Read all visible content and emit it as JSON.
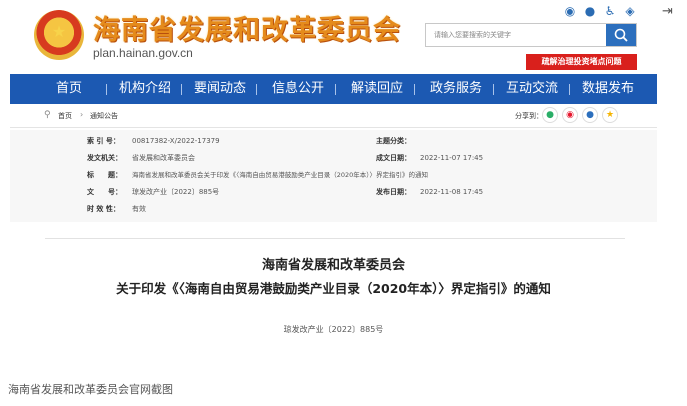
{
  "header": {
    "site_title": "海南省发展和改革委员会",
    "site_domain": "plan.hainan.gov.cn",
    "search_placeholder": "请输入您要搜索的关键字",
    "promo_label": "疏解治理投资堵点问题",
    "top_icons": [
      "weibo-icon",
      "wechat-icon",
      "accessibility-icon",
      "weibo-share-icon"
    ]
  },
  "nav": {
    "items": [
      {
        "label": "首页"
      },
      {
        "label": "机构介绍"
      },
      {
        "label": "要闻动态"
      },
      {
        "label": "信息公开"
      },
      {
        "label": "解读回应"
      },
      {
        "label": "政务服务"
      },
      {
        "label": "互动交流"
      },
      {
        "label": "数据发布"
      }
    ]
  },
  "breadcrumb": {
    "home": "首页",
    "current": "通知公告",
    "share_label": "分享到："
  },
  "meta": {
    "index_label": "索 引 号：",
    "index_value": "00817382-X/2022-17379",
    "category_label": "主题分类：",
    "category_value": "",
    "issuer_label": "发文机关：",
    "issuer_value": "省发展和改革委员会",
    "created_label": "成文日期：",
    "created_value": "2022-11-07 17:45",
    "title_label": "标　　题：",
    "title_value": "海南省发展和改革委员会关于印发《〈海南自由贸易港鼓励类产业目录（2020年本）〉界定指引》的通知",
    "docno_label": "文　　号：",
    "docno_value": "琼发改产业〔2022〕885号",
    "published_label": "发布日期：",
    "published_value": "2022-11-08 17:45",
    "validity_label": "时 效 性：",
    "validity_value": "有效"
  },
  "article": {
    "org_title": "海南省发展和改革委员会",
    "doc_title": "关于印发《〈海南自由贸易港鼓励类产业目录（2020年本）〉界定指引》的通知",
    "doc_number": "琼发改产业〔2022〕885号"
  },
  "caption": "海南省发展和改革委员会官网截图",
  "colors": {
    "nav_bg": "#1c59b2",
    "title_orange": "#e58b1c",
    "promo_red": "#d9201c",
    "search_blue": "#2c6fbd"
  }
}
